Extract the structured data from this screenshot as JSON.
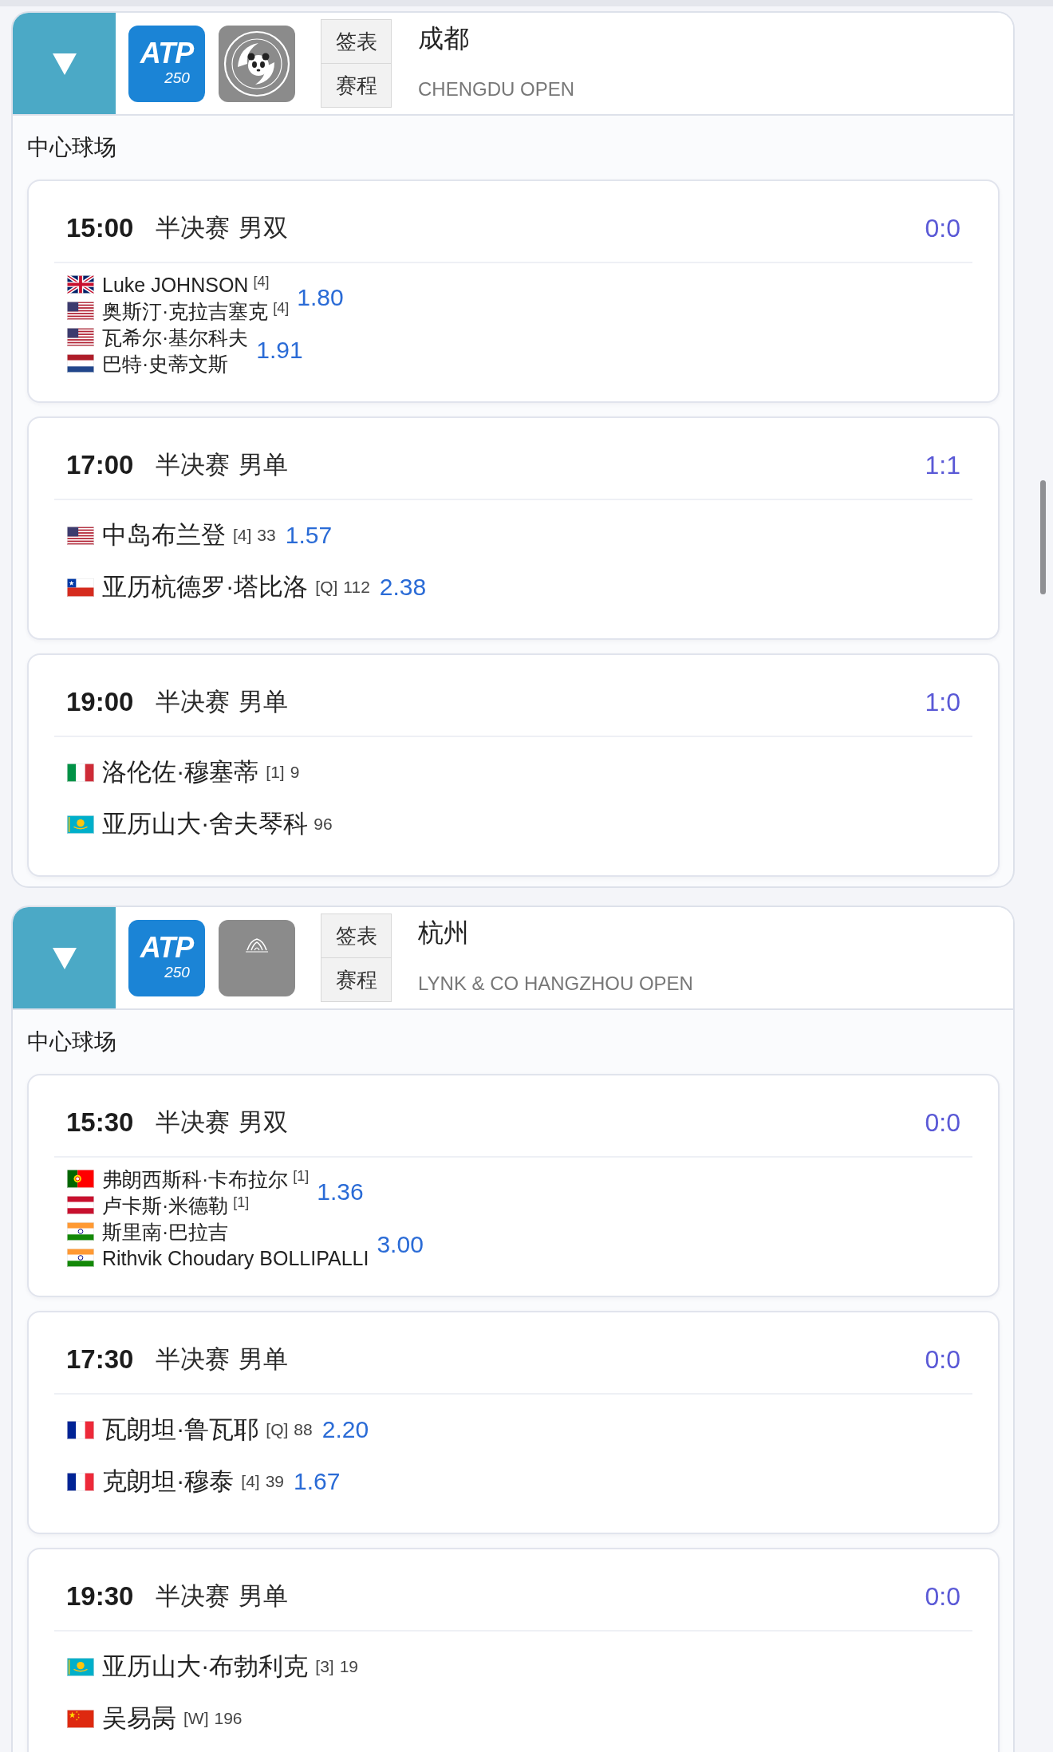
{
  "tournaments": [
    {
      "expanded": true,
      "tour_logo": {
        "wordmark": "ATP",
        "level": "250"
      },
      "emblem": {
        "kind": "panda"
      },
      "buttons": [
        "签表",
        "赛程"
      ],
      "title": "成都",
      "subtitle": "CHENGDU OPEN",
      "court": "中心球场",
      "matches": [
        {
          "kind": "doubles",
          "time": "15:00",
          "round": "半决赛",
          "event": "男双",
          "score": "0:0",
          "teams": [
            {
              "players": [
                {
                  "flag": {
                    "kind": "gb"
                  },
                  "name": "Luke JOHNSON",
                  "seed": "[4]"
                },
                {
                  "flag": {
                    "kind": "us"
                  },
                  "name": "奥斯汀·克拉吉塞克",
                  "seed": "[4]"
                }
              ],
              "odds": "1.80"
            },
            {
              "players": [
                {
                  "flag": {
                    "kind": "us"
                  },
                  "name": "瓦希尔·基尔科夫"
                },
                {
                  "flag": {
                    "kind": "nl"
                  },
                  "name": "巴特·史蒂文斯"
                }
              ],
              "odds": "1.91"
            }
          ]
        },
        {
          "kind": "singles",
          "time": "17:00",
          "round": "半决赛",
          "event": "男单",
          "score": "1:1",
          "teams": [
            {
              "players": [
                {
                  "flag": {
                    "kind": "us"
                  },
                  "name": "中岛布兰登",
                  "seed": "[4]",
                  "rank": "33"
                }
              ],
              "odds": "1.57"
            },
            {
              "players": [
                {
                  "flag": {
                    "kind": "cl"
                  },
                  "name": "亚历杭德罗·塔比洛",
                  "seed": "[Q]",
                  "rank": "112"
                }
              ],
              "odds": "2.38"
            }
          ]
        },
        {
          "kind": "singles",
          "time": "19:00",
          "round": "半决赛",
          "event": "男单",
          "score": "1:0",
          "teams": [
            {
              "players": [
                {
                  "flag": {
                    "kind": "it"
                  },
                  "name": "洛伦佐·穆塞蒂",
                  "seed": "[1]",
                  "rank": "9"
                }
              ]
            },
            {
              "players": [
                {
                  "flag": {
                    "kind": "kz"
                  },
                  "name": "亚历山大·舍夫琴科",
                  "rank": "96"
                }
              ]
            }
          ]
        }
      ]
    },
    {
      "expanded": true,
      "tour_logo": {
        "wordmark": "ATP",
        "level": "250"
      },
      "emblem": {
        "kind": "hangzhou"
      },
      "buttons": [
        "签表",
        "赛程"
      ],
      "title": "杭州",
      "subtitle": "LYNK & CO HANGZHOU OPEN",
      "court": "中心球场",
      "matches": [
        {
          "kind": "doubles",
          "time": "15:30",
          "round": "半决赛",
          "event": "男双",
          "score": "0:0",
          "teams": [
            {
              "players": [
                {
                  "flag": {
                    "kind": "pt"
                  },
                  "name": "弗朗西斯科·卡布拉尔",
                  "seed": "[1]"
                },
                {
                  "flag": {
                    "kind": "at"
                  },
                  "name": "卢卡斯·米德勒",
                  "seed": "[1]"
                }
              ],
              "odds": "1.36"
            },
            {
              "players": [
                {
                  "flag": {
                    "kind": "in"
                  },
                  "name": "斯里南·巴拉吉"
                },
                {
                  "flag": {
                    "kind": "in"
                  },
                  "name": "Rithvik Choudary BOLLIPALLI"
                }
              ],
              "odds": "3.00"
            }
          ]
        },
        {
          "kind": "singles",
          "time": "17:30",
          "round": "半决赛",
          "event": "男单",
          "score": "0:0",
          "teams": [
            {
              "players": [
                {
                  "flag": {
                    "kind": "fr"
                  },
                  "name": "瓦朗坦·鲁瓦耶",
                  "seed": "[Q]",
                  "rank": "88"
                }
              ],
              "odds": "2.20"
            },
            {
              "players": [
                {
                  "flag": {
                    "kind": "fr"
                  },
                  "name": "克朗坦·穆泰",
                  "seed": "[4]",
                  "rank": "39"
                }
              ],
              "odds": "1.67"
            }
          ]
        },
        {
          "kind": "singles",
          "time": "19:30",
          "round": "半决赛",
          "event": "男单",
          "score": "0:0",
          "teams": [
            {
              "players": [
                {
                  "flag": {
                    "kind": "kz"
                  },
                  "name": "亚历山大·布勃利克",
                  "seed": "[3]",
                  "rank": "19"
                }
              ]
            },
            {
              "players": [
                {
                  "flag": {
                    "kind": "cn"
                  },
                  "name": "吴易昺",
                  "seed": "[W]",
                  "rank": "196"
                }
              ]
            }
          ]
        }
      ]
    }
  ]
}
